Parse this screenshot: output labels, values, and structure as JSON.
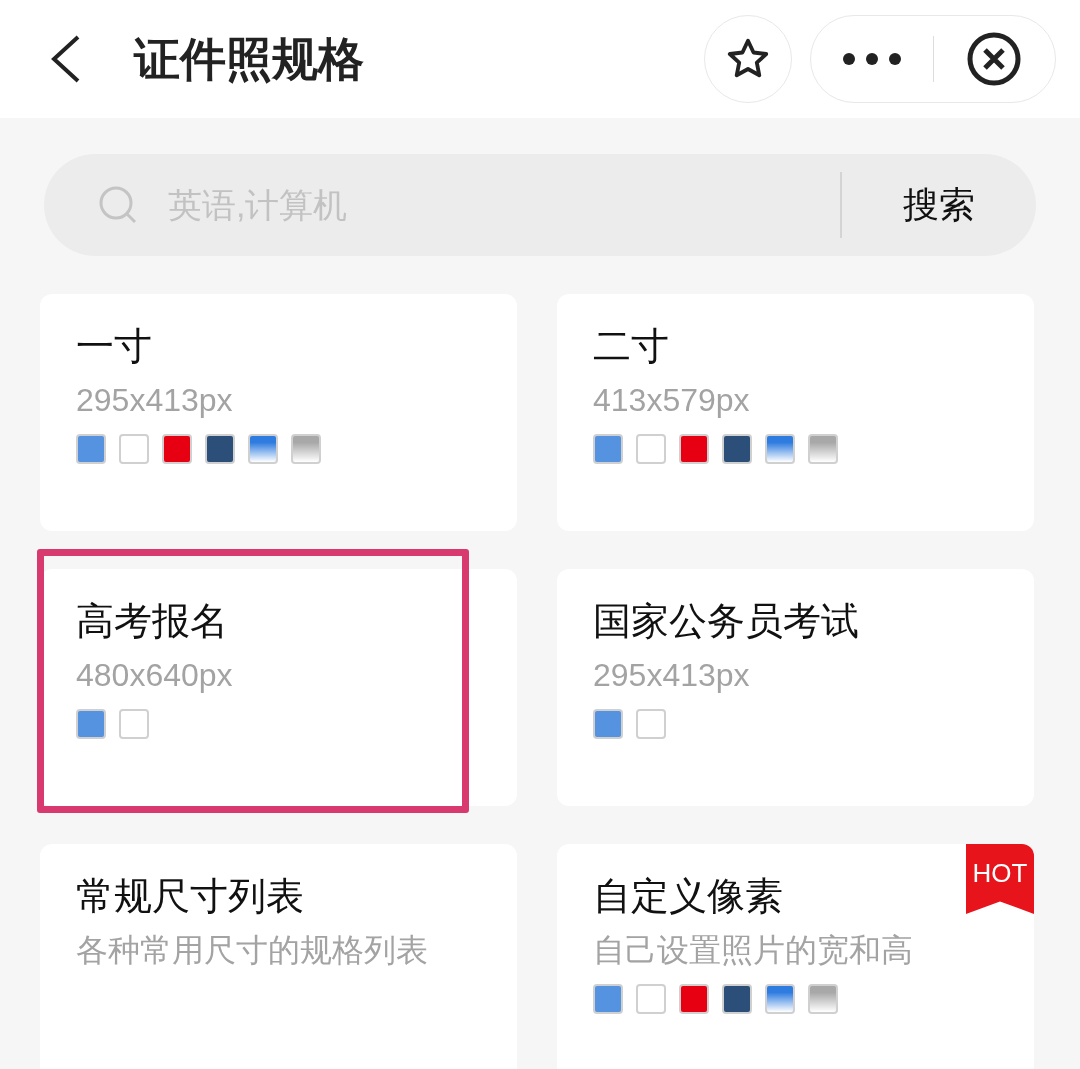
{
  "header": {
    "title": "证件照规格"
  },
  "search": {
    "placeholder": "英语,计算机",
    "button": "搜索"
  },
  "cards": [
    {
      "title": "一寸",
      "subtitle": "295x413px",
      "highlighted": false,
      "hot": false,
      "swatches": [
        {
          "kind": "solid",
          "color": "#5592e0"
        },
        {
          "kind": "solid",
          "color": "#ffffff"
        },
        {
          "kind": "solid",
          "color": "#e60012"
        },
        {
          "kind": "solid",
          "color": "#2b4f78"
        },
        {
          "kind": "gradient",
          "color": "#2f7ce0"
        },
        {
          "kind": "gradient",
          "color": "#a8a8a8"
        }
      ]
    },
    {
      "title": "二寸",
      "subtitle": "413x579px",
      "highlighted": false,
      "hot": false,
      "swatches": [
        {
          "kind": "solid",
          "color": "#5592e0"
        },
        {
          "kind": "solid",
          "color": "#ffffff"
        },
        {
          "kind": "solid",
          "color": "#e60012"
        },
        {
          "kind": "solid",
          "color": "#2b4f78"
        },
        {
          "kind": "gradient",
          "color": "#2f7ce0"
        },
        {
          "kind": "gradient",
          "color": "#a8a8a8"
        }
      ]
    },
    {
      "title": "高考报名",
      "subtitle": "480x640px",
      "highlighted": true,
      "hot": false,
      "swatches": [
        {
          "kind": "solid",
          "color": "#5592e0"
        },
        {
          "kind": "solid",
          "color": "#ffffff"
        }
      ]
    },
    {
      "title": "国家公务员考试",
      "subtitle": "295x413px",
      "highlighted": false,
      "hot": false,
      "swatches": [
        {
          "kind": "solid",
          "color": "#5592e0"
        },
        {
          "kind": "solid",
          "color": "#ffffff"
        }
      ]
    },
    {
      "title": "常规尺寸列表",
      "subtitle": "各种常用尺寸的规格列表",
      "highlighted": false,
      "hot": false
    },
    {
      "title": "自定义像素",
      "subtitle": "自己设置照片的宽和高",
      "highlighted": false,
      "hot": true,
      "badge": "HOT",
      "swatches": [
        {
          "kind": "solid",
          "color": "#5592e0"
        },
        {
          "kind": "solid",
          "color": "#ffffff"
        },
        {
          "kind": "solid",
          "color": "#e60012"
        },
        {
          "kind": "solid",
          "color": "#2b4f78"
        },
        {
          "kind": "gradient",
          "color": "#2f7ce0"
        },
        {
          "kind": "gradient",
          "color": "#a8a8a8"
        }
      ]
    }
  ]
}
